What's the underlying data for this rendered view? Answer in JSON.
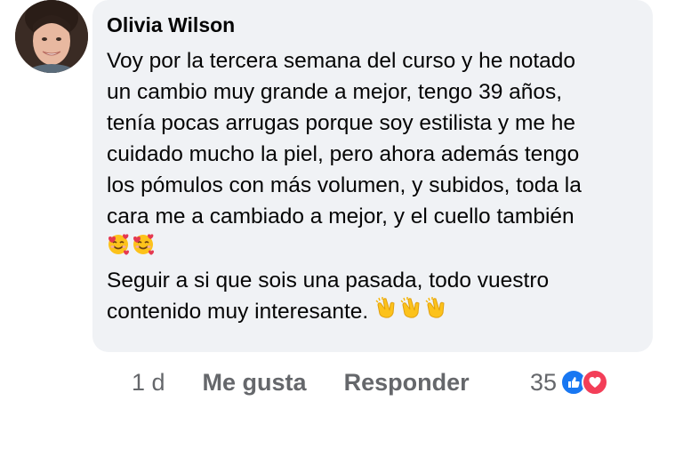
{
  "comment": {
    "author": "Olivia Wilson",
    "lines": [
      "Voy por la tercera semana del curso y he notado",
      "un cambio muy grande a mejor, tengo 39 años,",
      "tenía pocas arrugas porque soy estilista y me he",
      "cuidado mucho la piel, pero ahora además tengo",
      "los pómulos con más volumen, y subidos, toda la",
      "cara me a cambiado a mejor, y el cuello también"
    ],
    "emoji_line_1": [
      "smiling-face-with-hearts",
      "smiling-face-with-hearts"
    ],
    "line_7": "Seguir a si que sois una pasada, todo vuestro",
    "line_8": "contenido muy interesante.",
    "emoji_line_2": [
      "clapping-hands",
      "clapping-hands",
      "clapping-hands"
    ]
  },
  "actions": {
    "time": "1 d",
    "like_label": "Me gusta",
    "reply_label": "Responder"
  },
  "reactions": {
    "count": "35",
    "types": [
      "like",
      "love"
    ],
    "colors": {
      "like": "#1877f2",
      "love": "#f33e58"
    }
  }
}
